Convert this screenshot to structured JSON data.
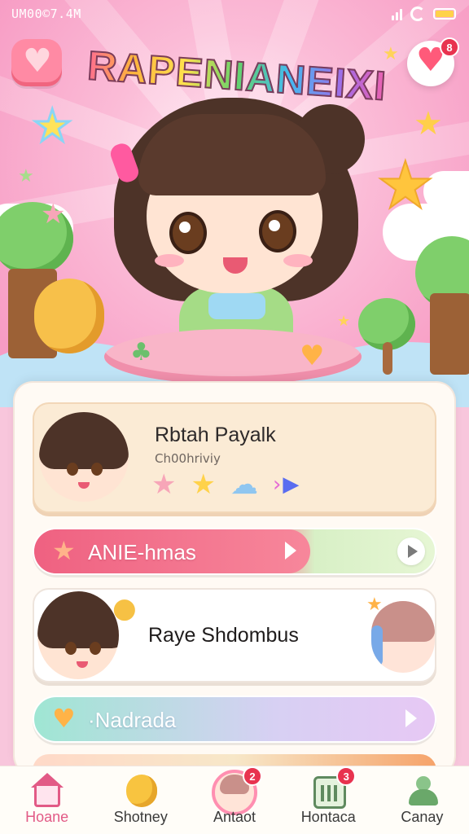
{
  "status_bar": {
    "time": "UM00©7.4M"
  },
  "hero": {
    "title": "RAPENIANEIXI",
    "notification_count": "8"
  },
  "profile_card": {
    "title": "Rbtah Payalk",
    "subtitle": "Ch00hriviy",
    "icons": [
      "star-icon",
      "star-icon",
      "cloud-icon",
      "play-icon"
    ]
  },
  "anime_bar": {
    "label": "ANIE-hmas",
    "icon": "star-icon",
    "progress": 0.69,
    "colors": {
      "fill": "#ef6181",
      "track": "#e6f6d4"
    }
  },
  "friend_card": {
    "name": "Raye Shdombus"
  },
  "nad_bar": {
    "label": "·Nadrada",
    "icon": "heart-icon"
  },
  "bottom_nav": {
    "items": [
      {
        "label": "Hoane",
        "icon": "home-icon",
        "active": true
      },
      {
        "label": "Shotney",
        "icon": "chick-icon"
      },
      {
        "label": "Antaot",
        "icon": "avatar-icon",
        "badge": "2"
      },
      {
        "label": "Hontaca",
        "icon": "calendar-icon",
        "badge": "3"
      },
      {
        "label": "Canay",
        "icon": "person-icon"
      }
    ]
  },
  "colors": {
    "accent": "#e25a86",
    "badge": "#e8334f",
    "hero_bg": "#f79cc4"
  }
}
